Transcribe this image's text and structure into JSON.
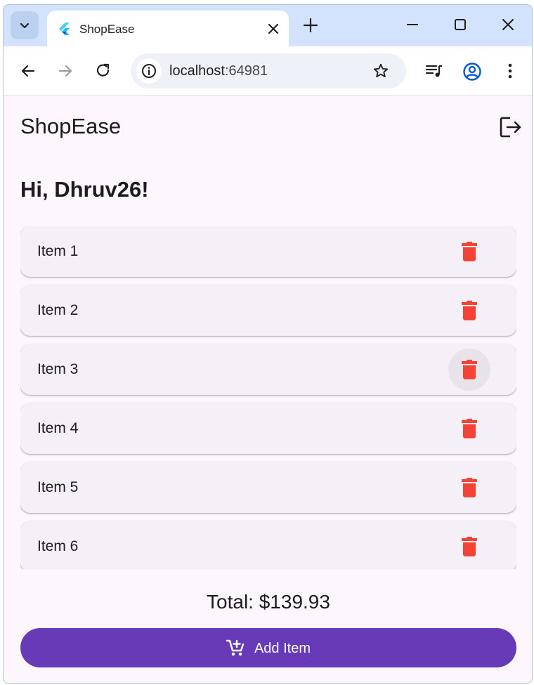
{
  "browser": {
    "tab_title": "ShopEase",
    "url_host": "localhost",
    "url_port": ":64981"
  },
  "app": {
    "title": "ShopEase",
    "greeting": "Hi, Dhruv26!",
    "items": [
      {
        "label": "Item 1"
      },
      {
        "label": "Item 2"
      },
      {
        "label": "Item 3"
      },
      {
        "label": "Item 4"
      },
      {
        "label": "Item 5"
      },
      {
        "label": "Item 6"
      }
    ],
    "total": "Total: $139.93",
    "add_button": "Add Item"
  },
  "colors": {
    "primary": "#673ab7",
    "delete": "#f44336",
    "card": "#f5eff7",
    "page": "#fdf7fd"
  },
  "icons": {
    "tab_search": "chevron-down-icon",
    "favicon": "flutter-icon",
    "delete": "trash-icon",
    "logout": "logout-icon",
    "add": "add-shopping-cart-icon"
  }
}
